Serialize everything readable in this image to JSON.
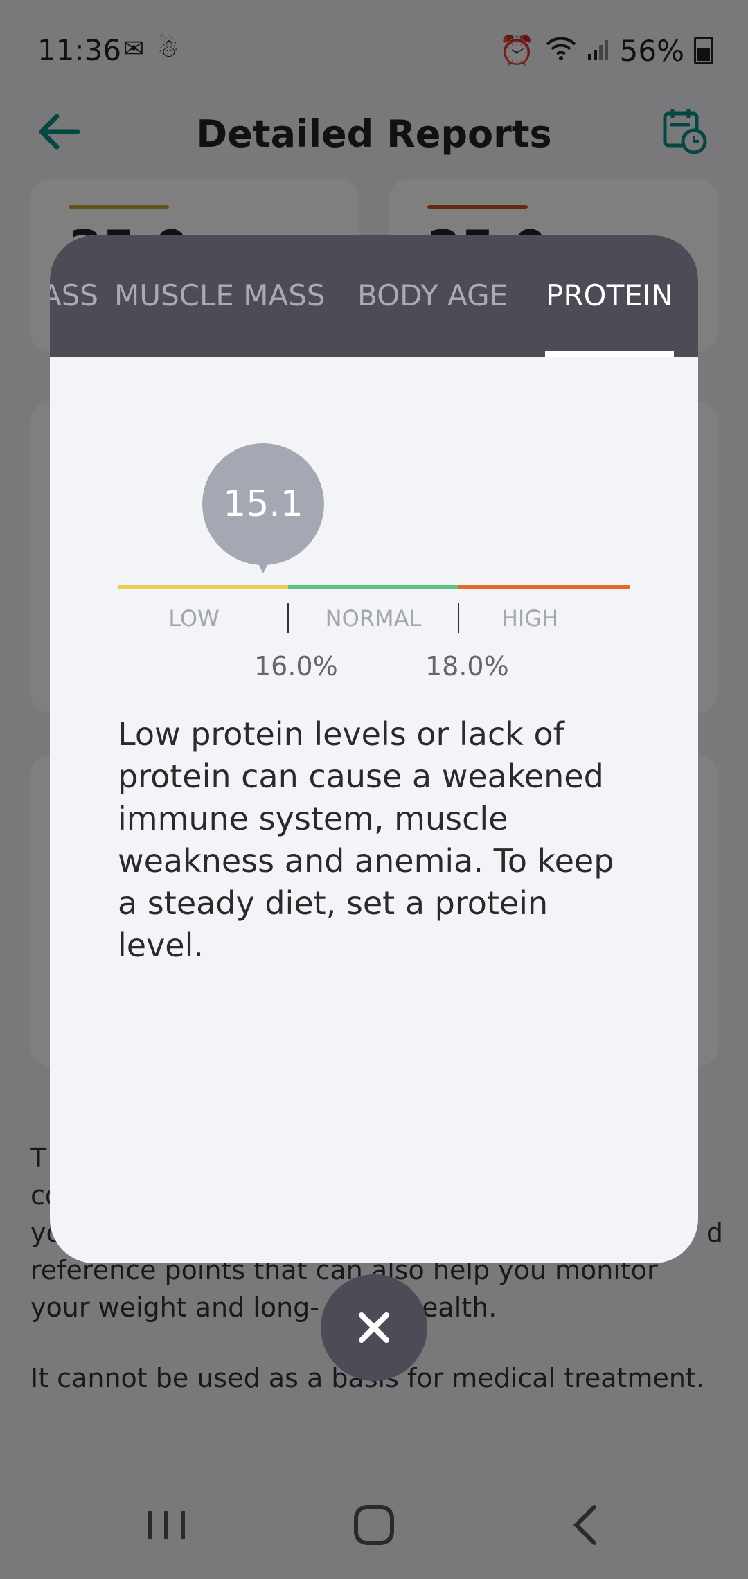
{
  "status_bar": {
    "time": "11:36",
    "battery": "56%"
  },
  "app_bar": {
    "title": "Detailed Reports"
  },
  "background_cards": [
    {
      "accent": "#c9a53a",
      "value_partial": "35.0"
    },
    {
      "accent": "#c8541e",
      "value_partial": "25.0"
    }
  ],
  "disclaimer": {
    "p1_fragments": [
      "T",
      "co",
      "yo",
      "d",
      "reference points that can also help you monitor",
      "your weight and long-",
      "ealth."
    ],
    "p2": "It cannot be used as a basis for medical treatment."
  },
  "modal": {
    "tabs": [
      {
        "label": "ASS",
        "active": false
      },
      {
        "label": "MUSCLE MASS",
        "active": false
      },
      {
        "label": "BODY AGE",
        "active": false
      },
      {
        "label": "PROTEIN",
        "active": true
      }
    ],
    "gauge": {
      "value": "15.1",
      "ranges": [
        "LOW",
        "NORMAL",
        "HIGH"
      ],
      "thresholds": [
        "16.0%",
        "18.0%"
      ],
      "colors": {
        "low": "#eccd52",
        "normal": "#5cc47e",
        "high": "#e26b2a"
      }
    },
    "description": "Low protein levels or lack of protein can cause a weakened immune system, muscle weakness and anemia. To keep a steady diet, set a protein level."
  },
  "icons": {
    "back": "arrow-left-icon",
    "calendar": "calendar-clock-icon",
    "close": "close-icon"
  }
}
